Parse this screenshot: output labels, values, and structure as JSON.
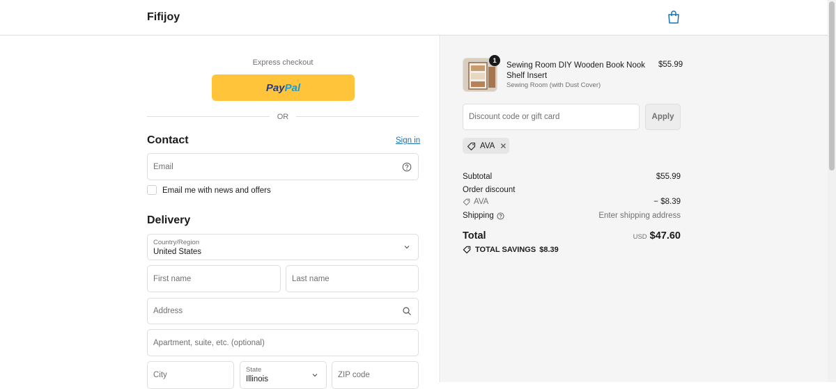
{
  "header": {
    "brand": "Fifijoy"
  },
  "express": {
    "label": "Express checkout",
    "paypal_part1": "Pay",
    "paypal_part2": "Pal",
    "divider": "OR"
  },
  "contact": {
    "title": "Contact",
    "sign_in": "Sign in",
    "email_placeholder": "Email",
    "newsletter_label": "Email me with news and offers"
  },
  "delivery": {
    "title": "Delivery",
    "country_label": "Country/Region",
    "country_value": "United States",
    "first_name_placeholder": "First name",
    "last_name_placeholder": "Last name",
    "address_placeholder": "Address",
    "apartment_placeholder": "Apartment, suite, etc. (optional)",
    "city_placeholder": "City",
    "state_label": "State",
    "state_value": "Illinois",
    "zip_placeholder": "ZIP code"
  },
  "summary": {
    "item": {
      "quantity": "1",
      "title": "Sewing Room DIY Wooden Book Nook Shelf Insert",
      "variant": "Sewing Room (with Dust Cover)",
      "price": "$55.99"
    },
    "discount_placeholder": "Discount code or gift card",
    "apply_label": "Apply",
    "applied_code": "AVA",
    "subtotal_label": "Subtotal",
    "subtotal_value": "$55.99",
    "order_discount_label": "Order discount",
    "discount_code": "AVA",
    "discount_value": "− $8.39",
    "shipping_label": "Shipping",
    "shipping_value": "Enter shipping address",
    "total_label": "Total",
    "currency": "USD",
    "total_value": "$47.60",
    "savings_label": "TOTAL SAVINGS",
    "savings_value": "$8.39"
  },
  "colors": {
    "accent": "#1773b0",
    "paypal_yellow": "#ffc439",
    "paypal_dark": "#253b80",
    "paypal_light": "#179bd7"
  }
}
